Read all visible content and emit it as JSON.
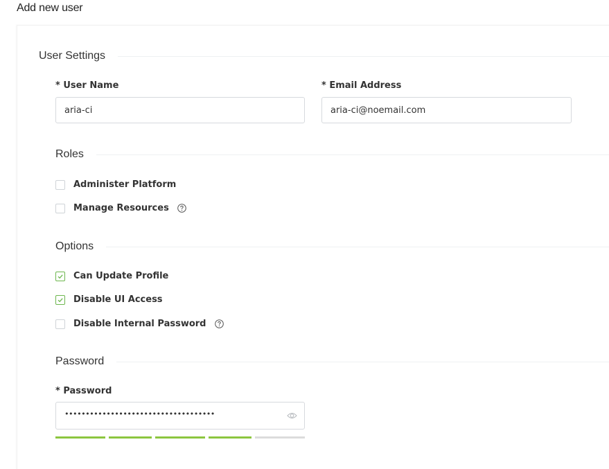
{
  "page": {
    "title": "Add new user"
  },
  "sections": {
    "user_settings": "User Settings",
    "roles": "Roles",
    "options": "Options",
    "password": "Password"
  },
  "fields": {
    "username": {
      "label": "* User Name",
      "value": "aria-ci"
    },
    "email": {
      "label": "* Email Address",
      "value": "aria-ci@noemail.com"
    },
    "password": {
      "label": "* Password",
      "masked": "••••••••••••••••••••••••••••••••••••"
    }
  },
  "roles": [
    {
      "label": "Administer Platform",
      "checked": false,
      "help": false
    },
    {
      "label": "Manage Resources",
      "checked": false,
      "help": true
    }
  ],
  "options": [
    {
      "label": "Can Update Profile",
      "checked": true,
      "help": false
    },
    {
      "label": "Disable UI Access",
      "checked": true,
      "help": false
    },
    {
      "label": "Disable Internal Password",
      "checked": false,
      "help": true
    }
  ],
  "password_strength": {
    "level": 4,
    "max": 5
  },
  "colors": {
    "accent_green": "#8cc63f",
    "check_green": "#6cb64d",
    "border": "#d6d9dd"
  },
  "icons": {
    "help": "help-circle-icon",
    "eye": "eye-icon",
    "check": "check-icon"
  }
}
